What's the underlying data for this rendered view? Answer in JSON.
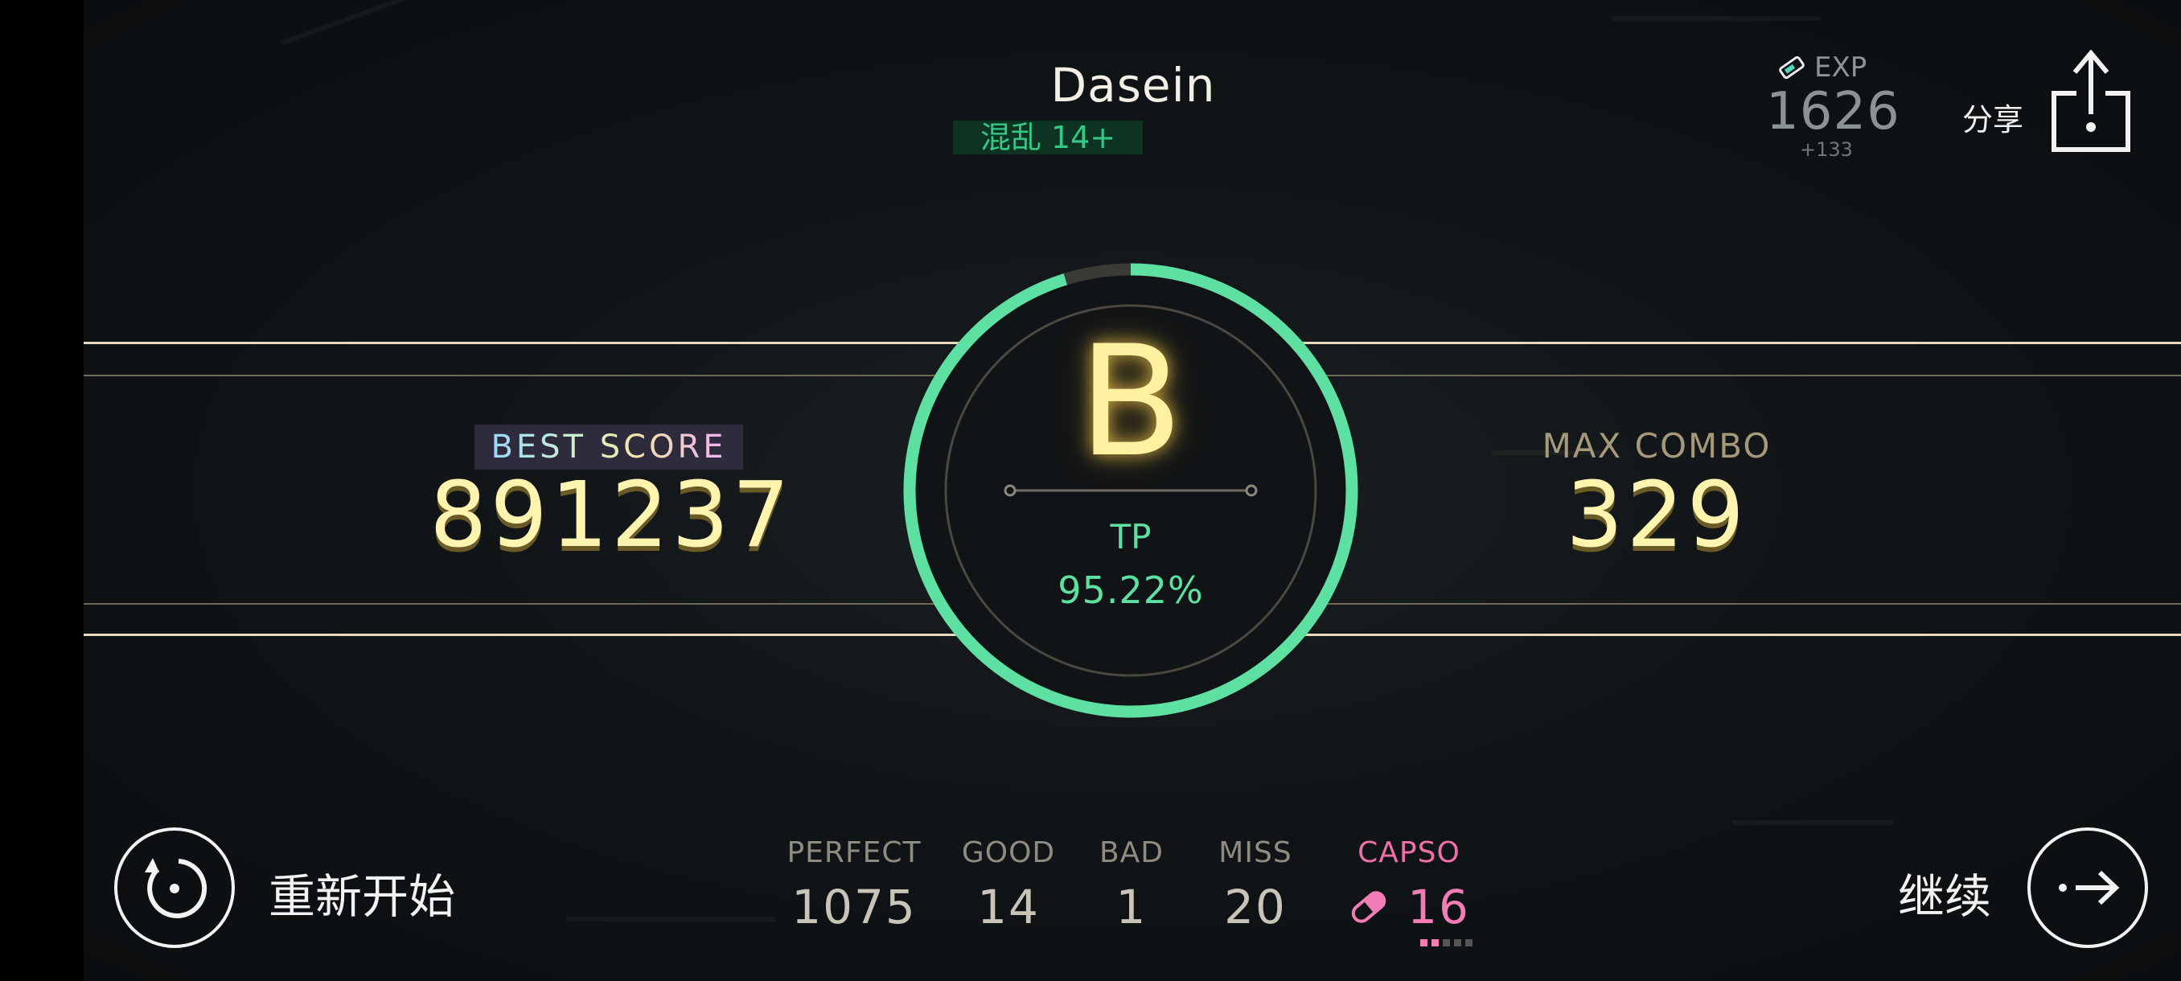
{
  "header": {
    "song_title": "Dasein",
    "difficulty": "混乱 14+"
  },
  "exp": {
    "icon": "exp-ticket-icon",
    "label": "EXP",
    "value": "1626",
    "delta": "+133"
  },
  "share": {
    "label": "分享",
    "icon": "share-upload-icon"
  },
  "result": {
    "grade": "B",
    "tp_label": "TP",
    "tp_value": "95.22%",
    "ring_fill_fraction": 0.9522,
    "ring_color": "#5ee0a2"
  },
  "best_score": {
    "label": "BEST SCORE",
    "value": "891237"
  },
  "max_combo": {
    "label": "MAX COMBO",
    "value": "329"
  },
  "judgments": [
    {
      "label": "PERFECT",
      "value": "1075"
    },
    {
      "label": "GOOD",
      "value": "14"
    },
    {
      "label": "BAD",
      "value": "1"
    },
    {
      "label": "MISS",
      "value": "20"
    }
  ],
  "capso": {
    "label": "CAPSO",
    "value": "16",
    "icon": "capsule-icon",
    "color": "#f27db4"
  },
  "controls": {
    "restart_label": "重新开始",
    "restart_icon": "restart-icon",
    "continue_label": "继续",
    "continue_icon": "arrow-right-icon"
  }
}
